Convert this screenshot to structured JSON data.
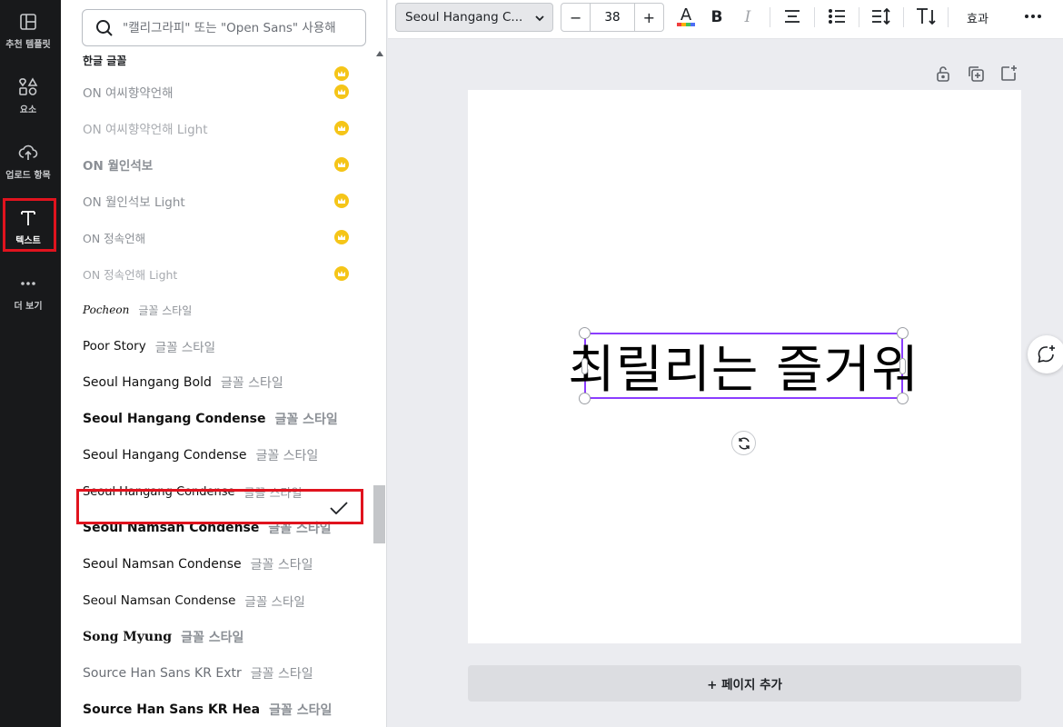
{
  "rail": {
    "items": [
      {
        "label": "추천 템플릿",
        "icon": "template-icon"
      },
      {
        "label": "요소",
        "icon": "elements-icon"
      },
      {
        "label": "업로드 항목",
        "icon": "upload-icon"
      },
      {
        "label": "텍스트",
        "icon": "text-icon",
        "active": true
      },
      {
        "label": "더 보기",
        "icon": "more-icon"
      }
    ]
  },
  "panel": {
    "search_placeholder": "\"캘리그라피\" 또는 \"Open Sans\" 사용해",
    "section_title": "한글 글꼴",
    "fonts": [
      {
        "name": "ON 여씨향약언해",
        "style": "",
        "pro": true
      },
      {
        "name": "ON 여씨향약언해 Light",
        "style": "",
        "pro": true
      },
      {
        "name": "ON 월인석보",
        "style": "",
        "pro": true
      },
      {
        "name": "ON 월인석보 Light",
        "style": "",
        "pro": true
      },
      {
        "name": "ON 정속언해",
        "style": "",
        "pro": true
      },
      {
        "name": "ON 정속언해 Light",
        "style": "",
        "pro": true
      },
      {
        "name": "Pocheon",
        "style": "글꼴 스타일",
        "pro": false
      },
      {
        "name": "Poor Story",
        "style": "글꼴 스타일",
        "pro": false
      },
      {
        "name": "Seoul Hangang Bold",
        "style": "글꼴 스타일",
        "pro": false
      },
      {
        "name": "Seoul Hangang Condense",
        "style": "글꼴 스타일",
        "pro": false
      },
      {
        "name": "Seoul Hangang Condense",
        "style": "글꼴 스타일",
        "pro": false
      },
      {
        "name": "Seoul Hangang Condense",
        "style": "글꼴 스타일",
        "pro": false,
        "selected": true
      },
      {
        "name": "Seoul Namsan Condense",
        "style": "글꼴 스타일",
        "pro": false
      },
      {
        "name": "Seoul Namsan Condense",
        "style": "글꼴 스타일",
        "pro": false
      },
      {
        "name": "Seoul Namsan Condense",
        "style": "글꼴 스타일",
        "pro": false
      },
      {
        "name": "Song Myung",
        "style": "글꼴 스타일",
        "pro": false
      },
      {
        "name": "Source Han Sans KR Extr",
        "style": "글꼴 스타일",
        "pro": false
      },
      {
        "name": "Source Han Sans KR Hea",
        "style": "글꼴 스타일",
        "pro": false
      }
    ]
  },
  "toolbar": {
    "font_name": "Seoul Hangang C...",
    "font_size": "38",
    "minus": "−",
    "plus": "+",
    "effects_label": "효과"
  },
  "canvas": {
    "text": "최릴리는 즐거워",
    "add_page_label": "+ 페이지 추가"
  },
  "colors": {
    "accent": "#8b3dff",
    "highlight": "#e0131e",
    "crown": "#f5c518"
  }
}
